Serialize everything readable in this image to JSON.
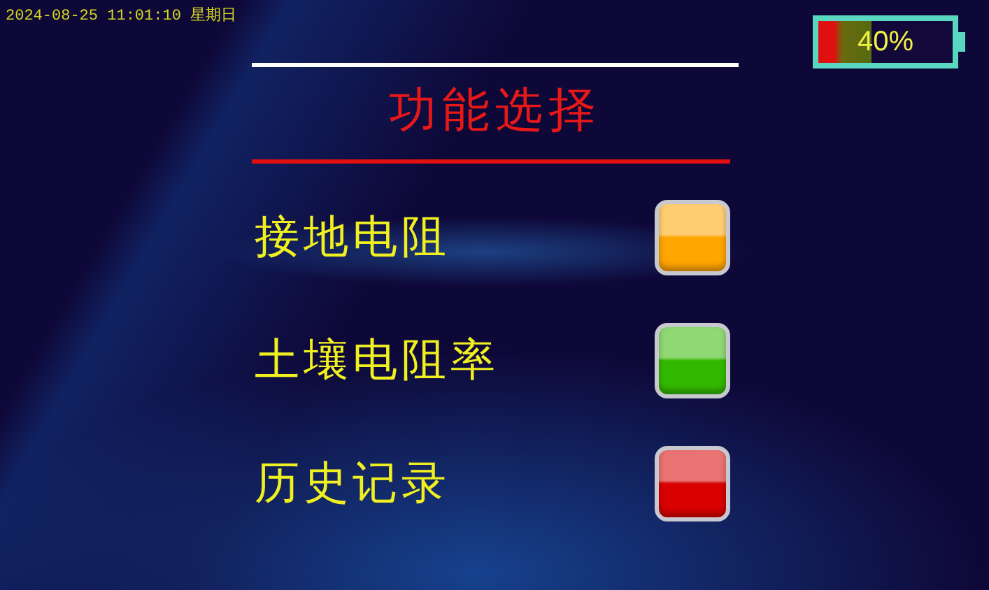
{
  "status_bar": {
    "datetime": "2024-08-25 11:01:10 星期日",
    "battery": {
      "level": 0.4,
      "reading": "40%"
    }
  },
  "title": "功能选择",
  "menu": [
    {
      "label": "接地电阻",
      "color": "#ffa500"
    },
    {
      "label": "土壤电阻率",
      "color": "#33b800"
    },
    {
      "label": "历史记录",
      "color": "#d80000"
    }
  ]
}
